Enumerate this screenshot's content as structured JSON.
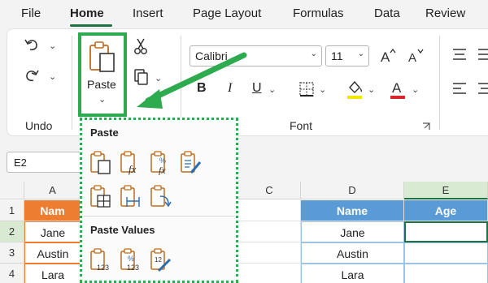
{
  "menu": {
    "tabs": [
      "File",
      "Home",
      "Insert",
      "Page Layout",
      "Formulas",
      "Data",
      "Review"
    ],
    "active_tab": "Home"
  },
  "ribbon": {
    "undo_group_label": "Undo",
    "paste_label": "Paste",
    "font_group_label": "Font",
    "font_name": "Calibri",
    "font_size": "11",
    "bold_label": "B",
    "italic_label": "I",
    "underline_label": "U",
    "highlight_color": "#f2e600",
    "font_color": "#d9262b"
  },
  "name_box": {
    "value": "E2"
  },
  "grid": {
    "columns": [
      "A",
      "C",
      "D",
      "E"
    ],
    "rows": [
      "1",
      "2",
      "3",
      "4"
    ],
    "a_cells": [
      "Nam",
      "Jane",
      "Austin",
      "Lara"
    ],
    "d_header": "Name",
    "e_header": "Age",
    "d_cells": [
      "Jane",
      "Austin",
      "Lara"
    ],
    "header_fill_a": "#ed7d31",
    "header_fill_d": "#5b9bd5"
  },
  "paste_menu": {
    "paste_heading": "Paste",
    "paste_values_heading": "Paste Values",
    "paste_icons": [
      "paste-icon",
      "paste-formulas-icon",
      "paste-formulas-number-formatting-icon",
      "keep-source-formatting-icon",
      "no-borders-icon",
      "keep-source-column-widths-icon",
      "transpose-icon"
    ],
    "paste_values_icons": [
      "paste-values-icon",
      "values-number-formatting-icon",
      "values-source-formatting-icon"
    ]
  },
  "accent": "#2eaa4f"
}
